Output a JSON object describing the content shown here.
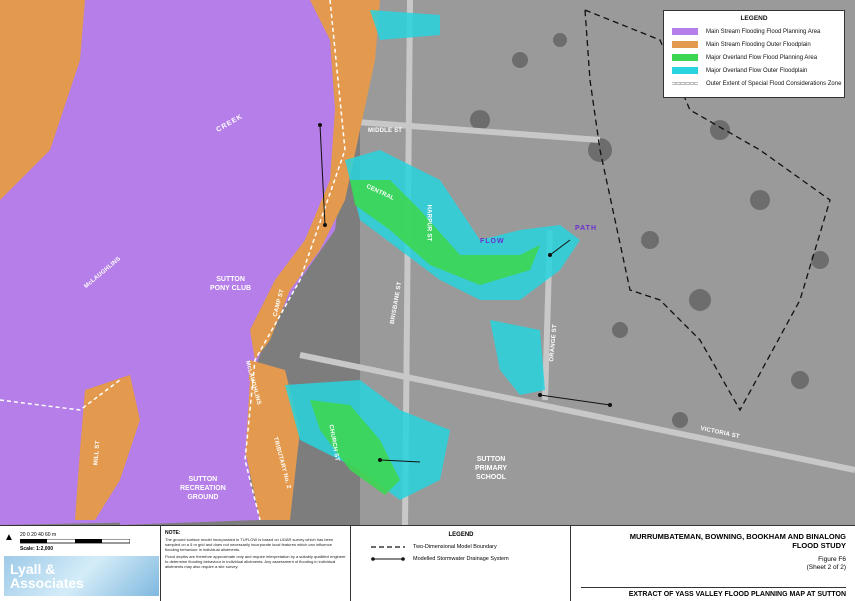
{
  "legend": {
    "title": "LEGEND",
    "items": [
      {
        "label": "Main Stream Flooding Flood Planning Area",
        "color": "#b57ee8"
      },
      {
        "label": "Main Stream Flooding Outer Floodplain",
        "color": "#e39a4e"
      },
      {
        "label": "Major Overland Flow Flood Planning Area",
        "color": "#3cd652"
      },
      {
        "label": "Major Overland Flow Outer Floodplain",
        "color": "#28d4de"
      },
      {
        "label": "Outer Extent of Special Flood Considerations Zone",
        "color": "#cccccc"
      }
    ]
  },
  "map": {
    "roads": [
      "MIDDLE ST",
      "CENTRAL",
      "HARPUR ST",
      "CAMP ST",
      "McLAUGHLINS",
      "McLAUGHLINS",
      "CHURCH ST",
      "VICTORIA ST",
      "MILL ST",
      "TRIBUTARY No. 2",
      "ORANGE ST",
      "BRISBANE ST"
    ],
    "creek": [
      "CREEK",
      "FLOW",
      "PATH",
      "TRIBUTARY No. 2"
    ],
    "places": {
      "pony_club": "SUTTON\nPONY CLUB",
      "recreation": "SUTTON\nRECREATION\nGROUND",
      "school": "SUTTON\nPRIMARY\nSCHOOL"
    }
  },
  "footer": {
    "scale_numbers": "20    0    20    40    60 m",
    "scale_label": "Scale: 1:2,000",
    "logo": "Lyall &\nAssociates",
    "note_title": "NOTE:",
    "note_text_1": "The ground surface model incorporated in TUFLOW is based on LiDAR survey which has been sampled on a 5 m grid and does not necessarily incorporate local features which can influence flooding behaviour in individual allotments.",
    "note_text_2": "Flood depths are therefore approximate only and require interpretation by a suitably qualified engineer to determine flooding behaviour in individual allotments. Any assessment of flooding in individual allotments may also require a site survey.",
    "legend_title": "LEGEND",
    "legend_items": [
      "Two-Dimensional Model Boundary",
      "Modelled Stormwater Drainage System"
    ],
    "title_main": "MURRUMBATEMAN, BOWNING, BOOKHAM AND BINALONG\nFLOOD STUDY",
    "figure": "Figure F6",
    "sheet": "(Sheet 2 of 2)",
    "extract": "EXTRACT OF YASS VALLEY FLOOD PLANNING MAP AT SUTTON"
  }
}
